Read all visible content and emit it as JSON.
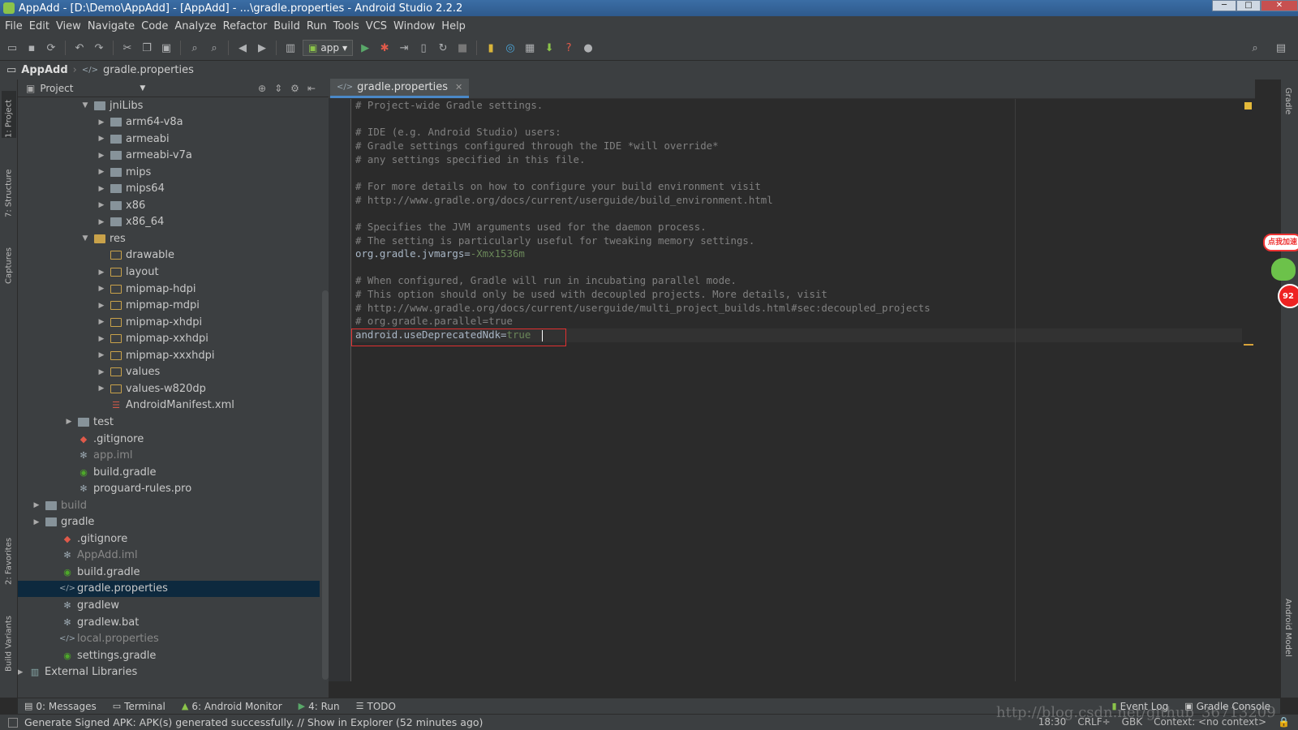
{
  "window": {
    "title": "AppAdd - [D:\\Demo\\AppAdd] - [AppAdd] - ...\\gradle.properties - Android Studio 2.2.2",
    "buttons": [
      "─",
      "□",
      "✕"
    ]
  },
  "menu": [
    "File",
    "Edit",
    "View",
    "Navigate",
    "Code",
    "Analyze",
    "Refactor",
    "Build",
    "Run",
    "Tools",
    "VCS",
    "Window",
    "Help"
  ],
  "toolbar": {
    "run_config": "app"
  },
  "breadcrumb": {
    "root": "AppAdd",
    "file": "gradle.properties"
  },
  "left_strip": [
    "1: Project",
    "7: Structure",
    "Captures",
    "2: Favorites",
    "Build Variants"
  ],
  "right_strip": [
    "Gradle",
    "Android Model"
  ],
  "project": {
    "header": "Project",
    "tree": [
      {
        "label": "jniLibs",
        "arrow": "▼",
        "icon": "folder"
      },
      {
        "label": "arm64-v8a",
        "arrow": "▶",
        "icon": "folder"
      },
      {
        "label": "armeabi",
        "arrow": "▶",
        "icon": "folder"
      },
      {
        "label": "armeabi-v7a",
        "arrow": "▶",
        "icon": "folder"
      },
      {
        "label": "mips",
        "arrow": "▶",
        "icon": "folder"
      },
      {
        "label": "mips64",
        "arrow": "▶",
        "icon": "folder"
      },
      {
        "label": "x86",
        "arrow": "▶",
        "icon": "folder"
      },
      {
        "label": "x86_64",
        "arrow": "▶",
        "icon": "folder"
      },
      {
        "label": "res",
        "arrow": "▼",
        "icon": "res-folder"
      },
      {
        "label": "drawable",
        "arrow": "",
        "icon": "res-subfolder"
      },
      {
        "label": "layout",
        "arrow": "▶",
        "icon": "res-subfolder"
      },
      {
        "label": "mipmap-hdpi",
        "arrow": "▶",
        "icon": "res-subfolder"
      },
      {
        "label": "mipmap-mdpi",
        "arrow": "▶",
        "icon": "res-subfolder"
      },
      {
        "label": "mipmap-xhdpi",
        "arrow": "▶",
        "icon": "res-subfolder"
      },
      {
        "label": "mipmap-xxhdpi",
        "arrow": "▶",
        "icon": "res-subfolder"
      },
      {
        "label": "mipmap-xxxhdpi",
        "arrow": "▶",
        "icon": "res-subfolder"
      },
      {
        "label": "values",
        "arrow": "▶",
        "icon": "res-subfolder"
      },
      {
        "label": "values-w820dp",
        "arrow": "▶",
        "icon": "res-subfolder"
      },
      {
        "label": "AndroidManifest.xml",
        "arrow": "",
        "icon": "xml"
      },
      {
        "label": "test",
        "arrow": "▶",
        "icon": "folder"
      },
      {
        "label": ".gitignore",
        "arrow": "",
        "icon": "git"
      },
      {
        "label": "app.iml",
        "arrow": "",
        "icon": "star",
        "dim": true
      },
      {
        "label": "build.gradle",
        "arrow": "",
        "icon": "gradle"
      },
      {
        "label": "proguard-rules.pro",
        "arrow": "",
        "icon": "star"
      },
      {
        "label": "build",
        "arrow": "▶",
        "icon": "folder",
        "dim": true
      },
      {
        "label": "gradle",
        "arrow": "▶",
        "icon": "folder"
      },
      {
        "label": ".gitignore",
        "arrow": "",
        "icon": "git"
      },
      {
        "label": "AppAdd.iml",
        "arrow": "",
        "icon": "star",
        "dim": true
      },
      {
        "label": "build.gradle",
        "arrow": "",
        "icon": "gradle"
      },
      {
        "label": "gradle.properties",
        "arrow": "",
        "icon": "prop",
        "selected": true
      },
      {
        "label": "gradlew",
        "arrow": "",
        "icon": "star"
      },
      {
        "label": "gradlew.bat",
        "arrow": "",
        "icon": "star"
      },
      {
        "label": "local.properties",
        "arrow": "",
        "icon": "prop",
        "dim": true
      },
      {
        "label": "settings.gradle",
        "arrow": "",
        "icon": "gradle"
      },
      {
        "label": "External Libraries",
        "arrow": "▶",
        "icon": "lib"
      }
    ]
  },
  "editor": {
    "tab": "gradle.properties",
    "lines": [
      "# Project-wide Gradle settings.",
      "",
      "# IDE (e.g. Android Studio) users:",
      "# Gradle settings configured through the IDE *will override*",
      "# any settings specified in this file.",
      "",
      "# For more details on how to configure your build environment visit",
      "# http://www.gradle.org/docs/current/userguide/build_environment.html",
      "",
      "# Specifies the JVM arguments used for the daemon process.",
      "# The setting is particularly useful for tweaking memory settings.",
      "org.gradle.jvmargs=-Xmx1536m",
      "",
      "# When configured, Gradle will run in incubating parallel mode.",
      "# This option should only be used with decoupled projects. More details, visit",
      "# http://www.gradle.org/docs/current/userguide/multi_project_builds.html#sec:decoupled_projects",
      "# org.gradle.parallel=true",
      "android.useDeprecatedNdk=true"
    ]
  },
  "floating_widget": {
    "bubble": "点我加速",
    "percent": "92"
  },
  "tool_windows": {
    "left": [
      {
        "label": "0: Messages",
        "icon": "messages-icon"
      },
      {
        "label": "Terminal",
        "icon": "terminal-icon"
      },
      {
        "label": "6: Android Monitor",
        "icon": "android-icon"
      },
      {
        "label": "4: Run",
        "icon": "run-icon"
      },
      {
        "label": "TODO",
        "icon": "todo-icon"
      }
    ],
    "right": [
      {
        "label": "Event Log",
        "icon": "event-log-icon"
      },
      {
        "label": "Gradle Console",
        "icon": "console-icon"
      }
    ]
  },
  "status": {
    "message": "Generate Signed APK: APK(s) generated successfully. // Show in Explorer (52 minutes ago)",
    "position": "18:30",
    "line_sep": "CRLF÷",
    "encoding": "GBK",
    "context": "Context: <no context>"
  },
  "watermark": "http://blog.csdn.net/github_36713209"
}
